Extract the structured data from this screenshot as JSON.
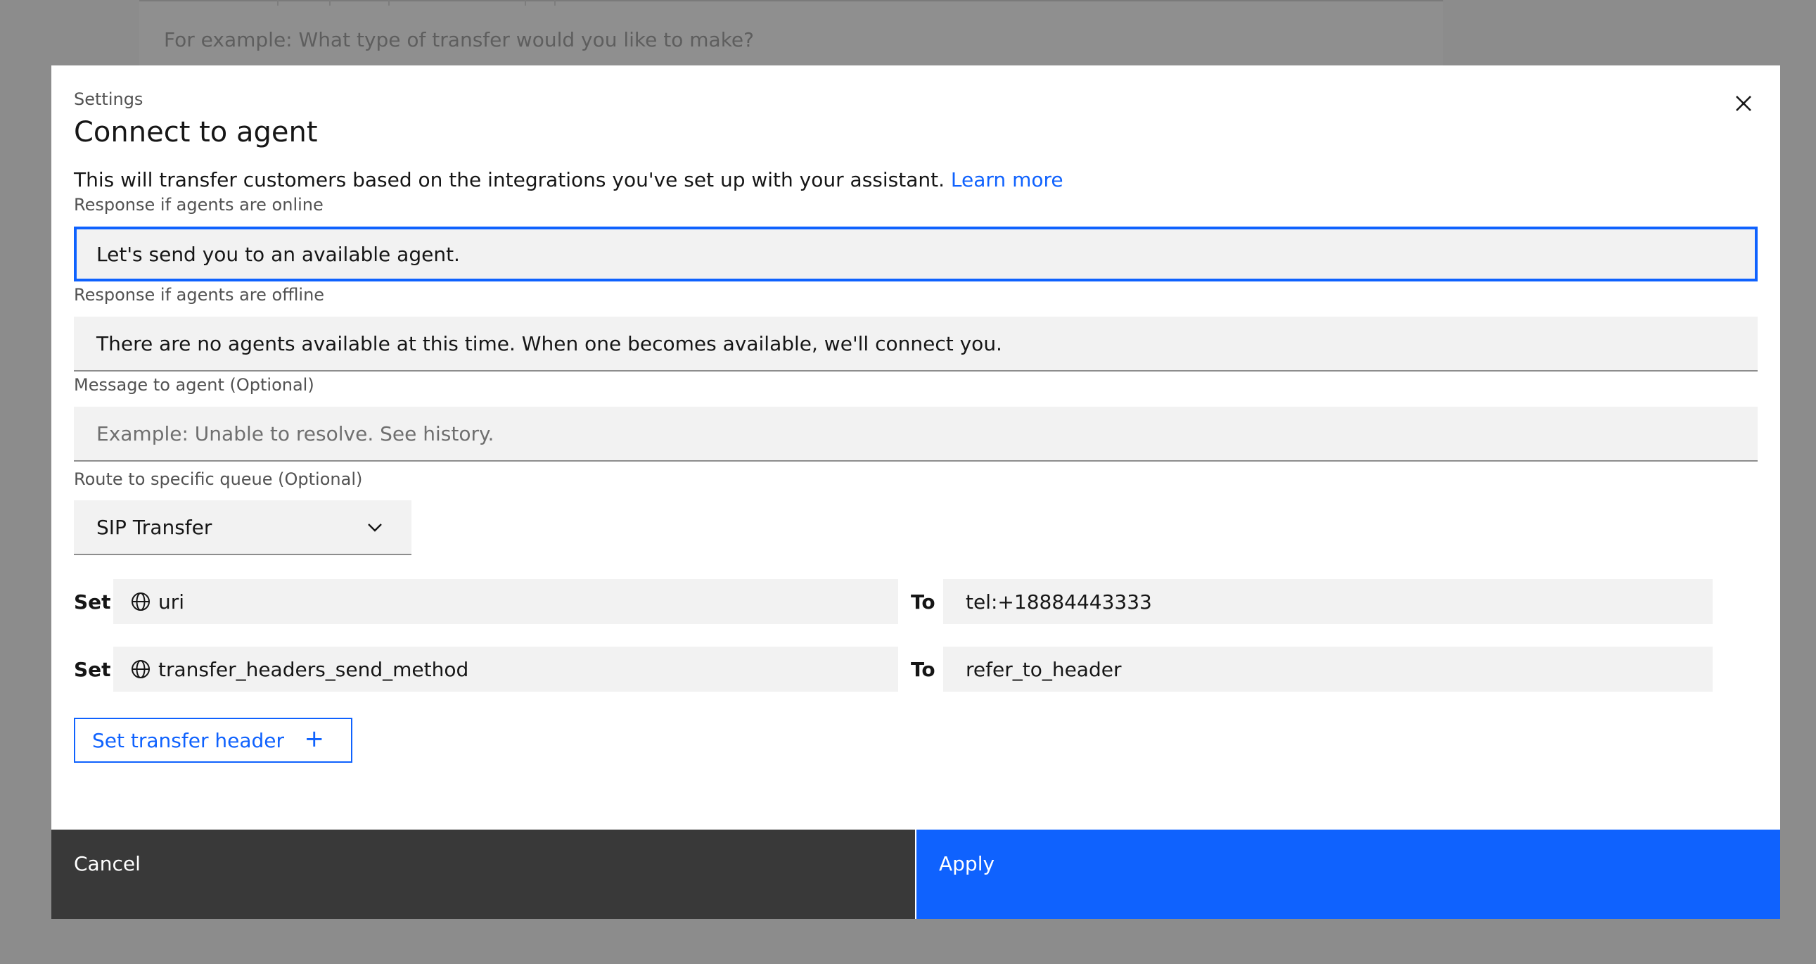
{
  "background": {
    "placeholder": "For example: What type of transfer would you like to make?"
  },
  "modal": {
    "label": "Settings",
    "title": "Connect to agent",
    "description": "This will transfer customers based on the integrations you've set up with your assistant.",
    "learn_more": "Learn more",
    "online": {
      "label": "Response if agents are online",
      "value": "Let's send you to an available agent."
    },
    "offline": {
      "label": "Response if agents are offline",
      "value": "There are no agents available at this time. When one becomes available, we'll connect you."
    },
    "message": {
      "label": "Message to agent (Optional)",
      "placeholder": "Example: Unable to resolve. See history."
    },
    "queue": {
      "label": "Route to specific queue (Optional)",
      "selected": "SIP Transfer"
    },
    "headers": [
      {
        "set_label": "Set",
        "variable": "uri",
        "to_label": "To",
        "value": "tel:+18884443333"
      },
      {
        "set_label": "Set",
        "variable": "transfer_headers_send_method",
        "to_label": "To",
        "value": "refer_to_header"
      }
    ],
    "add_header_label": "Set transfer header",
    "add_header_icon": "+",
    "cancel_label": "Cancel",
    "apply_label": "Apply"
  },
  "colors": {
    "accent": "#0f62fe",
    "cancel_bg": "#393939",
    "overlay": "#8c8c8c",
    "field_bg": "#f2f2f2"
  },
  "icons": {
    "close": "close-icon",
    "chevron": "chevron-down-icon",
    "variable": "globe-icon",
    "add": "plus-icon"
  }
}
